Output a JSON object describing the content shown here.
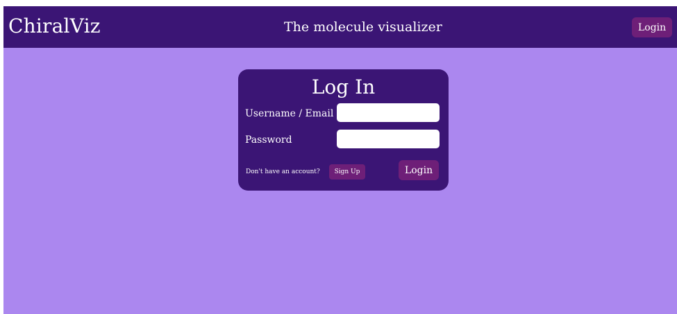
{
  "navbar": {
    "brand": "ChiralViz",
    "tagline": "The molecule visualizer",
    "login_label": "Login"
  },
  "login_card": {
    "title": "Log In",
    "username_label": "Username / Email",
    "username_value": "",
    "password_label": "Password",
    "password_value": "",
    "no_account_text": "Don't have an account?",
    "signup_label": "Sign Up",
    "login_label": "Login"
  },
  "colors": {
    "page_background": "#ab87ef",
    "navbar_background": "#3b1575",
    "card_background": "#3b1575",
    "button_background": "#6e1f78",
    "text": "#ffffff"
  }
}
